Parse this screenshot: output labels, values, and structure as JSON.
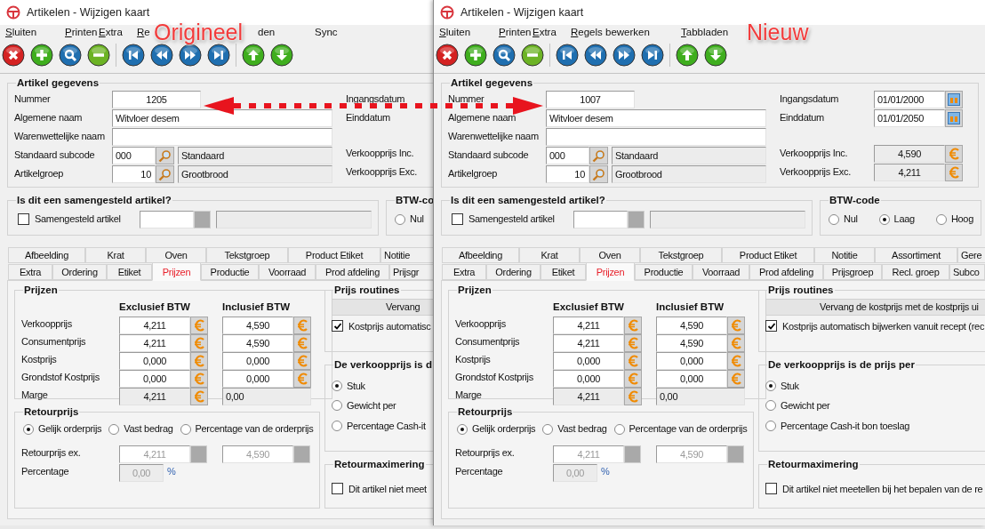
{
  "windows": [
    {
      "title": "Artikelen - Wijzigen kaart",
      "menu": [
        {
          "label": "Sluiten",
          "mnemonic": true,
          "cut_start": false
        },
        {
          "label": "Printen",
          "mnemonic": true,
          "cut_start": false
        },
        {
          "label": "Extra",
          "mnemonic": true,
          "cut_start": false
        },
        {
          "label": "Re",
          "mnemonic": true,
          "cut_start": false
        },
        {
          "label": "den",
          "mnemonic": false,
          "cut_start": true
        },
        {
          "label": "Sync",
          "mnemonic": false,
          "cut_start": false
        }
      ],
      "artikel": {
        "title": "Artikel gegevens",
        "left": [
          {
            "kind": "number",
            "label": "Nummer",
            "value": "1205"
          },
          {
            "kind": "text",
            "label": "Algemene naam",
            "value": "Witvloer desem"
          },
          {
            "kind": "text",
            "label": "Warenwettelijke naam"
          },
          {
            "kind": "lookup",
            "label": "Standaard subcode",
            "value": "000",
            "description": "Standaard"
          },
          {
            "kind": "lookup",
            "label": "Artikelgroep",
            "value": "10",
            "description": "Grootbrood"
          }
        ],
        "right": [
          {
            "kind": "date",
            "label": "Ingangsdatum"
          },
          {
            "kind": "date",
            "label": "Einddatum"
          },
          {
            "kind": "price",
            "label": "Verkoopprijs Inc."
          },
          {
            "kind": "price",
            "label": "Verkoopprijs Exc."
          }
        ]
      },
      "samengesteld": {
        "title": "Is dit een samengesteld artikel?",
        "checkbox": {
          "label": "Samengesteld artikel",
          "checked": false
        }
      },
      "btw": {
        "title": "BTW-co",
        "options": [
          {
            "label": "Nul",
            "selected": false
          }
        ]
      },
      "tab_rows": [
        {
          "tabs": [
            {
              "label": "Afbeelding",
              "selected": false
            },
            {
              "label": "Krat",
              "selected": false
            },
            {
              "label": "Oven",
              "selected": false
            },
            {
              "label": "Tekstgroep",
              "selected": false
            },
            {
              "label": "Product Etiket",
              "selected": false
            },
            {
              "label": "Notitie",
              "selected": false
            }
          ]
        },
        {
          "tabs": [
            {
              "label": "Extra",
              "selected": false
            },
            {
              "label": "Ordering",
              "selected": false
            },
            {
              "label": "Etiket",
              "selected": false
            },
            {
              "label": "Prijzen",
              "selected": true
            },
            {
              "label": "Productie",
              "selected": false
            },
            {
              "label": "Voorraad",
              "selected": false
            },
            {
              "label": "Prod afdeling",
              "selected": false
            },
            {
              "label": "Prijsgr",
              "selected": false
            }
          ]
        }
      ],
      "prijzen": {
        "title": "Prijzen",
        "columns": [
          "Exclusief BTW",
          "Inclusief BTW"
        ],
        "rows": [
          {
            "kind": "editable",
            "label": "Verkoopprijs",
            "excl": "4,211",
            "incl": "4,590"
          },
          {
            "kind": "editable",
            "label": "Consumentprijs",
            "excl": "4,211",
            "incl": "4,590"
          },
          {
            "kind": "editable",
            "label": "Kostprijs",
            "excl": "0,000",
            "incl": "0,000"
          },
          {
            "kind": "editable",
            "label": "Grondstof Kostprijs",
            "excl": "0,000",
            "incl": "0,000"
          },
          {
            "kind": "margin",
            "label": "Marge",
            "excl": "4,211",
            "incl": "0,00"
          }
        ]
      },
      "retourprijs": {
        "title": "Retourprijs",
        "options": [
          {
            "label": "Gelijk orderprijs",
            "selected": true
          },
          {
            "label": "Vast bedrag",
            "selected": false
          },
          {
            "label": "Percentage van de orderprijs",
            "selected": false
          }
        ],
        "amount": {
          "label": "Retourprijs ex.",
          "excl": "4,211",
          "incl": "4,590",
          "disabled": true
        },
        "percentage": {
          "label": "Percentage",
          "value": "0,00",
          "unit": "%",
          "disabled": true
        }
      },
      "routines": {
        "title": "Prijs routines",
        "button": "Vervang",
        "checkbox": {
          "label": "Kostprijs automatisc",
          "checked": true
        }
      },
      "prijs_per": {
        "title": "De verkoopprijs is d",
        "options": [
          {
            "label": "Stuk",
            "selected": true
          },
          {
            "label": "Gewicht per",
            "selected": false
          },
          {
            "label": "Percentage Cash-it",
            "selected": false
          }
        ]
      },
      "retourmax": {
        "title": "Retourmaximering",
        "checkbox": {
          "label": "Dit artikel niet meet",
          "checked": false
        }
      }
    },
    {
      "title": "Artikelen - Wijzigen kaart",
      "menu": [
        {
          "label": "Sluiten",
          "mnemonic": true,
          "cut_start": false
        },
        {
          "label": "Printen",
          "mnemonic": true,
          "cut_start": false
        },
        {
          "label": "Extra",
          "mnemonic": true,
          "cut_start": false
        },
        {
          "label": "Regels bewerken",
          "mnemonic": true,
          "cut_start": false
        },
        {
          "label": "Tabbladen",
          "mnemonic": true,
          "cut_start": false
        }
      ],
      "artikel": {
        "title": "Artikel gegevens",
        "left": [
          {
            "kind": "number",
            "label": "Nummer",
            "value": "1007"
          },
          {
            "kind": "text",
            "label": "Algemene naam",
            "value": "Witvloer desem"
          },
          {
            "kind": "text",
            "label": "Warenwettelijke naam"
          },
          {
            "kind": "lookup",
            "label": "Standaard subcode",
            "value": "000",
            "description": "Standaard"
          },
          {
            "kind": "lookup",
            "label": "Artikelgroep",
            "value": "10",
            "description": "Grootbrood"
          }
        ],
        "right": [
          {
            "kind": "date",
            "label": "Ingangsdatum",
            "value": "01/01/2000"
          },
          {
            "kind": "date",
            "label": "Einddatum",
            "value": "01/01/2050"
          },
          {
            "kind": "price",
            "label": "Verkoopprijs Inc.",
            "value": "4,590"
          },
          {
            "kind": "price",
            "label": "Verkoopprijs Exc.",
            "value": "4,211"
          }
        ]
      },
      "samengesteld": {
        "title": "Is dit een samengesteld artikel?",
        "checkbox": {
          "label": "Samengesteld artikel",
          "checked": false
        }
      },
      "btw": {
        "title": "BTW-code",
        "options": [
          {
            "label": "Nul",
            "selected": false
          },
          {
            "label": "Laag",
            "selected": true
          },
          {
            "label": "Hoog",
            "selected": false
          }
        ]
      },
      "tab_rows": [
        {
          "tabs": [
            {
              "label": "Afbeelding",
              "selected": false
            },
            {
              "label": "Krat",
              "selected": false
            },
            {
              "label": "Oven",
              "selected": false
            },
            {
              "label": "Tekstgroep",
              "selected": false
            },
            {
              "label": "Product Etiket",
              "selected": false
            },
            {
              "label": "Notitie",
              "selected": false
            },
            {
              "label": "Assortiment",
              "selected": false
            },
            {
              "label": "Gere",
              "selected": false
            }
          ]
        },
        {
          "tabs": [
            {
              "label": "Extra",
              "selected": false
            },
            {
              "label": "Ordering",
              "selected": false
            },
            {
              "label": "Etiket",
              "selected": false
            },
            {
              "label": "Prijzen",
              "selected": true
            },
            {
              "label": "Productie",
              "selected": false
            },
            {
              "label": "Voorraad",
              "selected": false
            },
            {
              "label": "Prod afdeling",
              "selected": false
            },
            {
              "label": "Prijsgroep",
              "selected": false
            },
            {
              "label": "Recl. groep",
              "selected": false
            },
            {
              "label": "Subco",
              "selected": false
            }
          ]
        }
      ],
      "prijzen": {
        "title": "Prijzen",
        "columns": [
          "Exclusief BTW",
          "Inclusief BTW"
        ],
        "rows": [
          {
            "kind": "editable",
            "label": "Verkoopprijs",
            "excl": "4,211",
            "incl": "4,590"
          },
          {
            "kind": "editable",
            "label": "Consumentprijs",
            "excl": "4,211",
            "incl": "4,590"
          },
          {
            "kind": "editable",
            "label": "Kostprijs",
            "excl": "0,000",
            "incl": "0,000"
          },
          {
            "kind": "editable",
            "label": "Grondstof Kostprijs",
            "excl": "0,000",
            "incl": "0,000"
          },
          {
            "kind": "margin",
            "label": "Marge",
            "excl": "4,211",
            "incl": "0,00"
          }
        ]
      },
      "retourprijs": {
        "title": "Retourprijs",
        "options": [
          {
            "label": "Gelijk orderprijs",
            "selected": true
          },
          {
            "label": "Vast bedrag",
            "selected": false
          },
          {
            "label": "Percentage van de orderprijs",
            "selected": false
          }
        ],
        "amount": {
          "label": "Retourprijs ex.",
          "excl": "4,211",
          "incl": "4,590",
          "disabled": true
        },
        "percentage": {
          "label": "Percentage",
          "value": "0,00",
          "unit": "%",
          "disabled": true
        }
      },
      "routines": {
        "title": "Prijs routines",
        "button": "Vervang de kostprijs met de kostprijs ui",
        "checkbox": {
          "label": "Kostprijs automatisch bijwerken vanuit recept (rec",
          "checked": true
        }
      },
      "prijs_per": {
        "title": "De verkoopprijs is de prijs per",
        "options": [
          {
            "label": "Stuk",
            "selected": true
          },
          {
            "label": "Gewicht per",
            "selected": false
          },
          {
            "label": "Percentage Cash-it bon toeslag",
            "selected": false
          }
        ]
      },
      "retourmax": {
        "title": "Retourmaximering",
        "checkbox": {
          "label": "Dit artikel niet meetellen bij het bepalen van de re",
          "checked": false
        }
      }
    }
  ],
  "annotations": [
    {
      "text": "Origineel"
    },
    {
      "text": "Nieuw"
    }
  ]
}
